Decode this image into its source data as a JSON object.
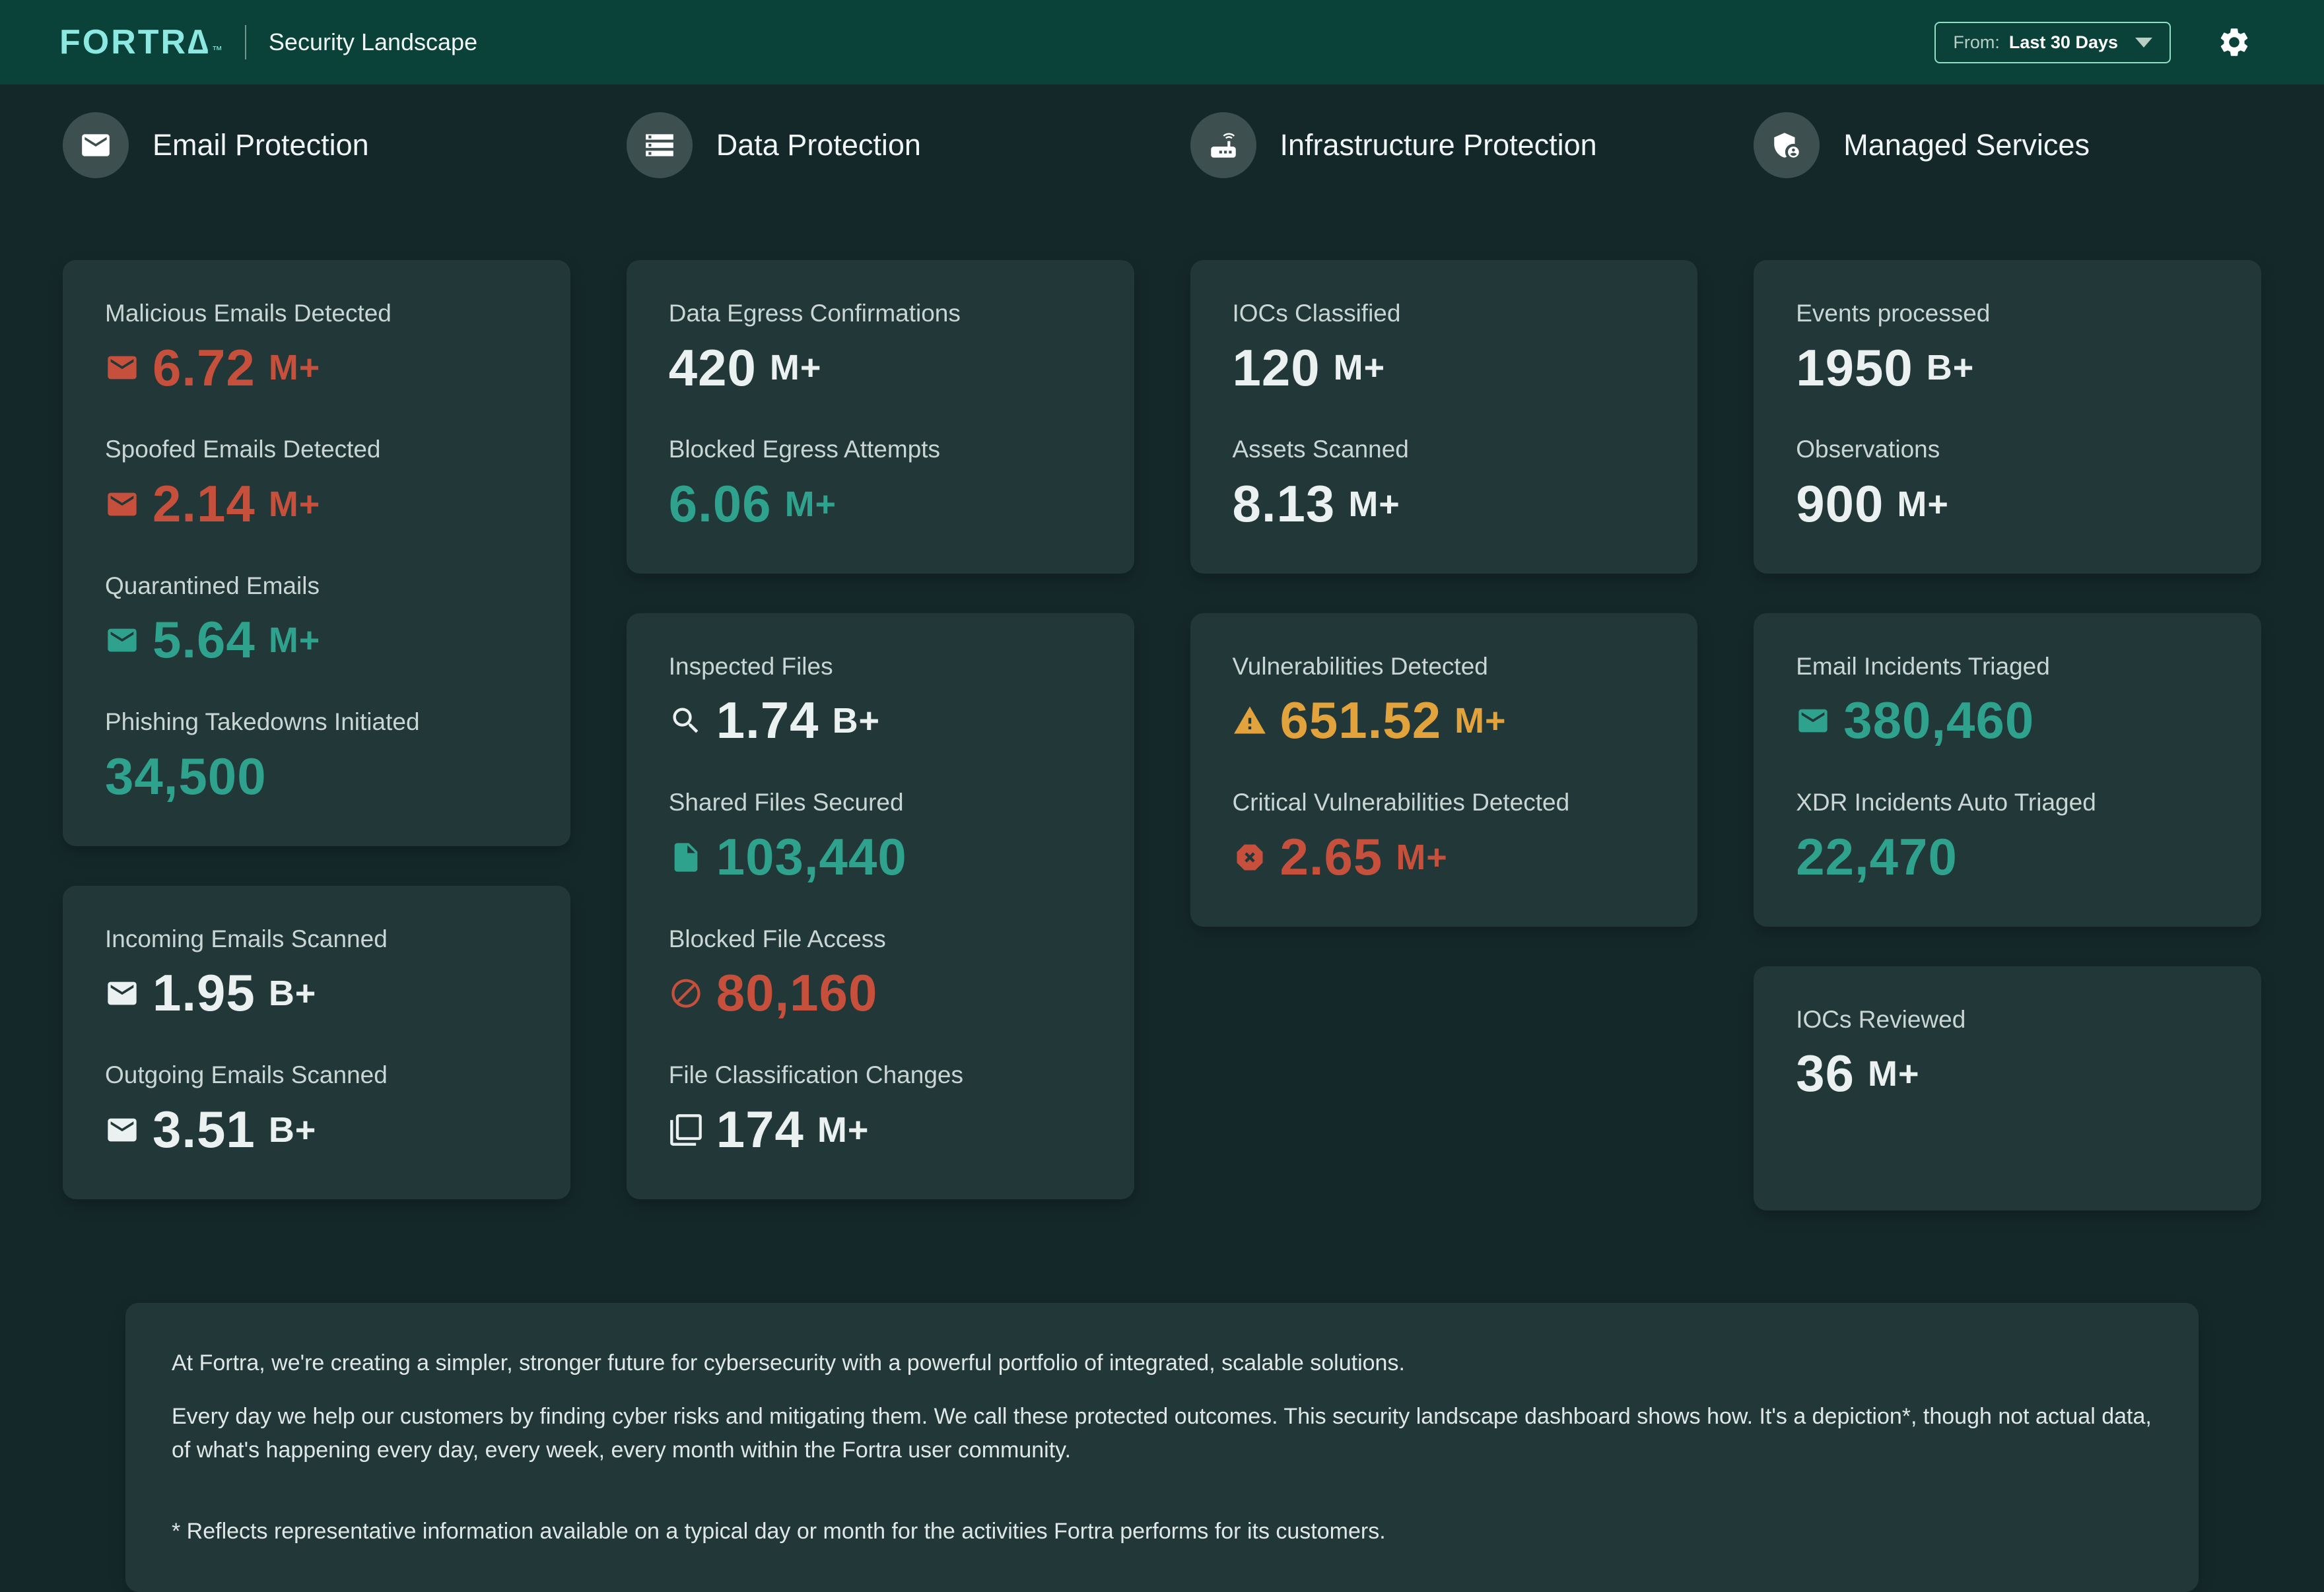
{
  "header": {
    "logo": "FORTR∆",
    "logo_tm": "™",
    "title": "Security Landscape",
    "range_label": "From:",
    "range_value": "Last 30 Days",
    "settings_icon": "gear-icon"
  },
  "palette": {
    "red": "#c7503c",
    "teal": "#2fa28d",
    "white": "#eaf1f0",
    "amber": "#e2a33d",
    "header_bg": "#0a4139",
    "page_bg": "#152829",
    "card_bg": "#223738",
    "logo_color": "#8ce9e1",
    "dropdown_border": "#8fdfc4"
  },
  "columns": [
    {
      "id": "email",
      "title": "Email Protection",
      "icon": "mail-icon",
      "cards": [
        {
          "metrics": [
            {
              "label": "Malicious Emails Detected",
              "value": "6.72",
              "suffix": "M+",
              "color": "red",
              "icon": "mail-icon"
            },
            {
              "label": "Spoofed Emails Detected",
              "value": "2.14",
              "suffix": "M+",
              "color": "red",
              "icon": "mail-icon"
            },
            {
              "label": "Quarantined Emails",
              "value": "5.64",
              "suffix": "M+",
              "color": "teal",
              "icon": "mail-icon"
            },
            {
              "label": "Phishing Takedowns Initiated",
              "value": "34,500",
              "suffix": "",
              "color": "teal",
              "icon": null
            }
          ]
        },
        {
          "metrics": [
            {
              "label": "Incoming Emails Scanned",
              "value": "1.95",
              "suffix": "B+",
              "color": "white",
              "icon": "mail-icon"
            },
            {
              "label": "Outgoing Emails Scanned",
              "value": "3.51",
              "suffix": "B+",
              "color": "white",
              "icon": "mail-icon"
            }
          ]
        }
      ]
    },
    {
      "id": "data",
      "title": "Data Protection",
      "icon": "storage-icon",
      "cards": [
        {
          "metrics": [
            {
              "label": "Data Egress Confirmations",
              "value": "420",
              "suffix": "M+",
              "color": "white",
              "icon": null
            },
            {
              "label": "Blocked Egress Attempts",
              "value": "6.06",
              "suffix": "M+",
              "color": "teal",
              "icon": null
            }
          ]
        },
        {
          "metrics": [
            {
              "label": "Inspected Files",
              "value": "1.74",
              "suffix": "B+",
              "color": "white",
              "icon": "search-icon"
            },
            {
              "label": "Shared Files Secured",
              "value": "103,440",
              "suffix": "",
              "color": "teal",
              "icon": "file-icon"
            },
            {
              "label": "Blocked File Access",
              "value": "80,160",
              "suffix": "",
              "color": "red",
              "icon": "block-icon"
            },
            {
              "label": "File Classification Changes",
              "value": "174",
              "suffix": "M+",
              "color": "white",
              "icon": "copy-icon"
            }
          ]
        }
      ]
    },
    {
      "id": "infra",
      "title": "Infrastructure Protection",
      "icon": "router-icon",
      "cards": [
        {
          "metrics": [
            {
              "label": "IOCs Classified",
              "value": "120",
              "suffix": "M+",
              "color": "white",
              "icon": null
            },
            {
              "label": "Assets Scanned",
              "value": "8.13",
              "suffix": "M+",
              "color": "white",
              "icon": null
            }
          ]
        },
        {
          "metrics": [
            {
              "label": "Vulnerabilities Detected",
              "value": "651.52",
              "suffix": "M+",
              "color": "amber",
              "icon": "warning-icon"
            },
            {
              "label": "Critical Vulnerabilities Detected",
              "value": "2.65",
              "suffix": "M+",
              "color": "red",
              "icon": "dangerous-icon"
            }
          ]
        }
      ]
    },
    {
      "id": "managed",
      "title": "Managed Services",
      "icon": "shield-person-icon",
      "cards": [
        {
          "metrics": [
            {
              "label": "Events processed",
              "value": "1950",
              "suffix": "B+",
              "color": "white",
              "icon": null
            },
            {
              "label": "Observations",
              "value": "900",
              "suffix": "M+",
              "color": "white",
              "icon": null
            }
          ]
        },
        {
          "metrics": [
            {
              "label": "Email Incidents Triaged",
              "value": "380,460",
              "suffix": "",
              "color": "teal",
              "icon": "mail-icon"
            },
            {
              "label": "XDR Incidents Auto Triaged",
              "value": "22,470",
              "suffix": "",
              "color": "teal",
              "icon": null
            }
          ]
        },
        {
          "metrics": [
            {
              "label": "IOCs Reviewed",
              "value": "36",
              "suffix": "M+",
              "color": "white",
              "icon": null
            }
          ]
        }
      ]
    }
  ],
  "footer": {
    "p1": "At Fortra, we're creating a simpler, stronger future for cybersecurity with a powerful portfolio of integrated, scalable solutions.",
    "p2": "Every day we help our customers by finding cyber risks and mitigating them. We call these protected outcomes. This security landscape dashboard shows how. It's a depiction*, though not actual data, of what's happening every day, every week, every month within the Fortra user community.",
    "footnote": "* Reflects representative information available on a typical day or month for the activities Fortra performs for its customers."
  }
}
